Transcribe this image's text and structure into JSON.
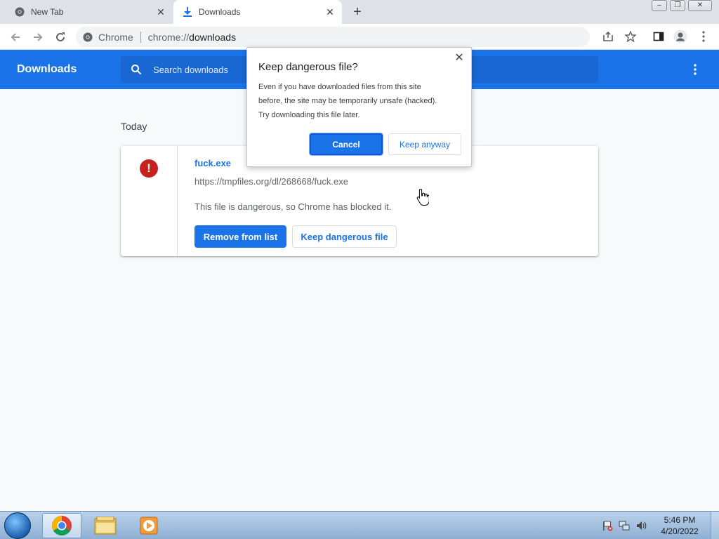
{
  "tabs": [
    {
      "title": "New Tab",
      "icon": "chrome-icon"
    },
    {
      "title": "Downloads",
      "icon": "download-icon"
    }
  ],
  "toolbar": {
    "chip_label": "Chrome",
    "url_prefix": "chrome://",
    "url_host": "downloads"
  },
  "downloads_page": {
    "title": "Downloads",
    "search_placeholder": "Search downloads",
    "date_group": "Today"
  },
  "download_item": {
    "file_name": "fuck.exe",
    "url": "https://tmpfiles.org/dl/268668/fuck.exe",
    "status": "This file is dangerous, so Chrome has blocked it.",
    "remove_label": "Remove from list",
    "keep_label": "Keep dangerous file"
  },
  "dialog": {
    "title": "Keep dangerous file?",
    "body_line1": "Even if you have downloaded files from this site",
    "body_line2": "before, the site may be temporarily unsafe (hacked).",
    "body_line3": "Try downloading this file later.",
    "cancel_label": "Cancel",
    "keep_label": "Keep anyway"
  },
  "taskbar": {
    "time": "5:46 PM",
    "date": "4/20/2022"
  },
  "colors": {
    "accent": "#1a73e8",
    "danger": "#c5221f"
  }
}
